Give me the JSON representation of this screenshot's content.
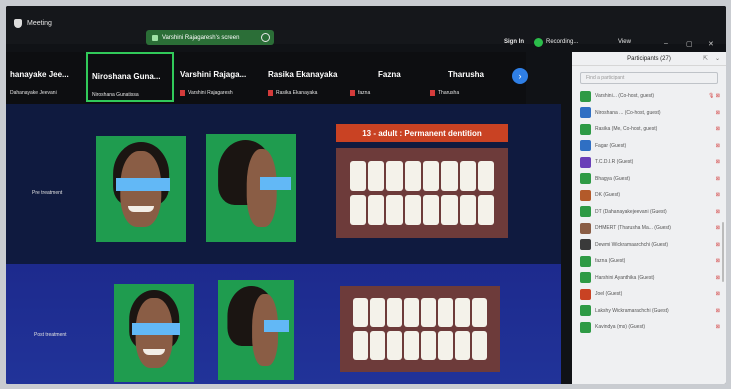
{
  "topbar": {
    "meeting_label": "Meeting",
    "share_label": "Varshini Rajagaresh's screen",
    "signin": "Sign In",
    "recording": "Recording...",
    "view": "View",
    "minimize": "–",
    "maximize": "▢",
    "close": "✕"
  },
  "strip": {
    "tiles": [
      {
        "name": "hanayake Jee...",
        "sub": "Dahanayake Jeevani",
        "muted": false
      },
      {
        "name": "Niroshana Guna...",
        "sub": "Niroshana Gunatissa",
        "muted": false
      },
      {
        "name": "Varshini Rajaga...",
        "sub": "Varshini Rajagaresh",
        "muted": true
      },
      {
        "name": "Rasika Ekanayaka",
        "sub": "Rasika Ekanayaka",
        "muted": true
      },
      {
        "name": "Fazna",
        "sub": "fazna",
        "muted": true
      },
      {
        "name": "Tharusha",
        "sub": "Tharusha",
        "muted": true
      }
    ],
    "next": "›"
  },
  "slide": {
    "title": "13 - adult  : Permanent dentition",
    "pre_label": "Pre treatment",
    "post_label": "Post treatment"
  },
  "panel": {
    "title": "Participants (27)",
    "search_placeholder": "Find a participant",
    "pop_icon": "⇱",
    "close_icon": "⌄",
    "rows": [
      {
        "name": "Varshini... (Co-host, guest)",
        "color": "#2e9a45",
        "status": "🎙 ⊠"
      },
      {
        "name": "Niroshana ... (Co-host, guest)",
        "color": "#2f6fc3",
        "status": "⊠"
      },
      {
        "name": "Rasika (Me, Co-host, guest)",
        "color": "#2e9a45",
        "status": "⊠"
      },
      {
        "name": "Fagar (Guest)",
        "color": "#2f6fc3",
        "status": "⊠"
      },
      {
        "name": "T.C.D.I.R (Guest)",
        "color": "#6a3fb8",
        "status": "⊠"
      },
      {
        "name": "Bhagya (Guest)",
        "color": "#2e9a45",
        "status": "⊠"
      },
      {
        "name": "DK (Guest)",
        "color": "#b35a2a",
        "status": "⊠"
      },
      {
        "name": "DT (Dahanayakejeevani (Guest)",
        "color": "#2e9a45",
        "status": "⊠"
      },
      {
        "name": "DHMERT (Tharusha Ma... (Guest)",
        "color": "#8a5d45",
        "status": "⊠"
      },
      {
        "name": "Dewmi Wickramaarchchi (Guest)",
        "color": "#3a3a3a",
        "status": "⊠"
      },
      {
        "name": "fazna (Guest)",
        "color": "#2e9a45",
        "status": "⊠"
      },
      {
        "name": "Harshini Ayanthika (Guest)",
        "color": "#2e9a45",
        "status": "⊠"
      },
      {
        "name": "Joel (Guest)",
        "color": "#c94223",
        "status": "⊠"
      },
      {
        "name": "Lakshy Wickramarachchi (Guest)",
        "color": "#2e9a45",
        "status": "⊠"
      },
      {
        "name": "Kavindya (ms) (Guest)",
        "color": "#2e9a45",
        "status": "⊠"
      }
    ]
  }
}
